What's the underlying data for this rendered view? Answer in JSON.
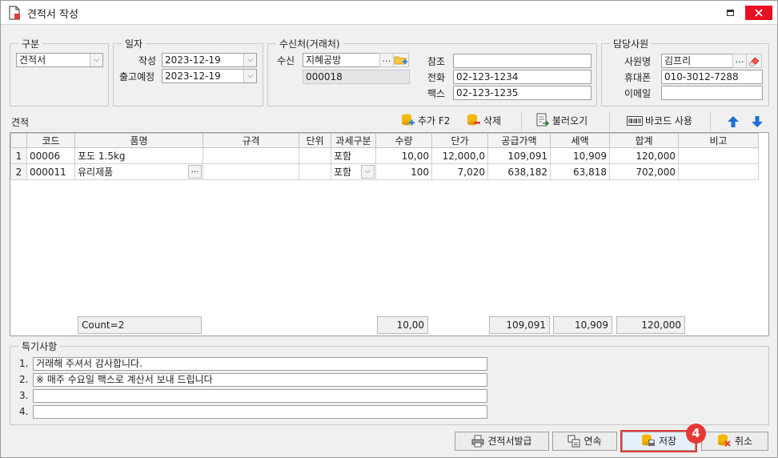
{
  "window": {
    "title": "견적서 작성"
  },
  "gubun": {
    "legend": "구분",
    "value": "견적서"
  },
  "ilja": {
    "legend": "일자",
    "created_label": "작성",
    "created_value": "2023-12-19",
    "ship_label": "출고예정",
    "ship_value": "2023-12-19"
  },
  "recipient": {
    "legend": "수신처(거래처)",
    "recv_label": "수신",
    "recv_value": "지혜공방",
    "code_value": "000018",
    "ref_label": "참조",
    "ref_value": "",
    "phone_label": "전화",
    "phone_value": "02-123-1234",
    "fax_label": "팩스",
    "fax_value": "02-123-1235"
  },
  "staff": {
    "legend": "담당사원",
    "name_label": "사원명",
    "name_value": "김프리",
    "mobile_label": "휴대폰",
    "mobile_value": "010-3012-7288",
    "email_label": "이메일",
    "email_value": ""
  },
  "section_label": "견적",
  "toolbar": {
    "add_label": "추가 F2",
    "delete_label": "삭제",
    "load_label": "불러오기",
    "barcode_label": "바코드 사용"
  },
  "grid": {
    "columns": [
      "",
      "코드",
      "품명",
      "규격",
      "단위",
      "과세구분",
      "수량",
      "단가",
      "공급가액",
      "세액",
      "합계",
      "비고"
    ],
    "rows": [
      [
        "1",
        "00006",
        "포도 1.5kg",
        "",
        "",
        "포함",
        "10,00",
        "12,000,0",
        "109,091",
        "10,909",
        "120,000",
        ""
      ],
      [
        "2",
        "000011",
        "유리제품",
        "",
        "",
        "포함",
        "100",
        "7,020",
        "638,182",
        "63,818",
        "702,000",
        ""
      ]
    ],
    "footer": {
      "count": "Count=2",
      "qty": "10,00",
      "supply": "109,091",
      "tax": "10,909",
      "total": "120,000"
    }
  },
  "notes": {
    "legend": "특기사항",
    "items": [
      {
        "num": "1.",
        "text": "거래해 주셔서 감사합니다."
      },
      {
        "num": "2.",
        "text": "※ 매주 수요일 팩스로 계산서 보내 드립니다"
      },
      {
        "num": "3.",
        "text": ""
      },
      {
        "num": "4.",
        "text": ""
      }
    ]
  },
  "buttons": {
    "issue_label": "견적서발급",
    "continuous_label": "연속",
    "save_label": "저장",
    "cancel_label": "취소"
  },
  "annotation": {
    "badge": "4"
  },
  "colors": {
    "highlight": "#e53935",
    "close": "#e81123"
  }
}
